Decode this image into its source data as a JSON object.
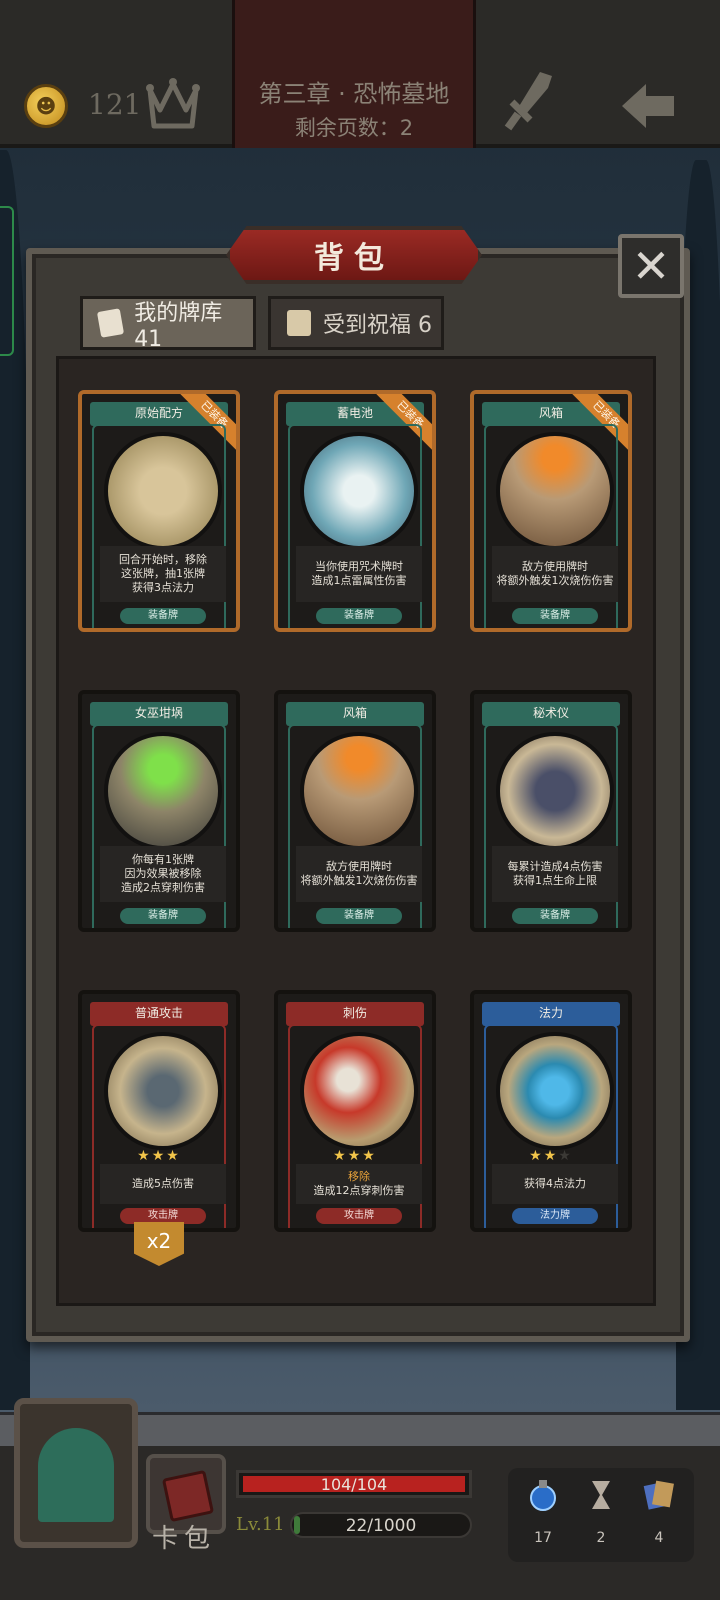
{
  "top": {
    "gold": "121",
    "chapter_title": "第三章 · 恐怖墓地",
    "pages_left": "剩余页数：2"
  },
  "panel": {
    "title": "背包",
    "close_glyph": "✕",
    "tabs": [
      {
        "label": "我的牌库 41",
        "active": true
      },
      {
        "label": "受到祝福 6",
        "active": false
      }
    ]
  },
  "cards": [
    {
      "name": "原始配方",
      "color": "green",
      "equipped": true,
      "equipped_label": "已装备",
      "desc": [
        "回合开始时，移除",
        "这张牌，抽1张牌",
        "获得3点法力"
      ],
      "kind": "装备牌"
    },
    {
      "name": "蓄电池",
      "color": "green",
      "equipped": true,
      "equipped_label": "已装备",
      "desc": [
        "当你使用咒术牌时",
        "造成1点雷属性伤害"
      ],
      "kind": "装备牌"
    },
    {
      "name": "风箱",
      "color": "green",
      "equipped": true,
      "equipped_label": "已装备",
      "desc": [
        "敌方使用牌时",
        "将额外触发1次烧伤伤害"
      ],
      "kind": "装备牌"
    },
    {
      "name": "女巫坩埚",
      "color": "green",
      "equipped": false,
      "desc": [
        "你每有1张牌",
        "因为效果被移除",
        "造成2点穿刺伤害"
      ],
      "kind": "装备牌"
    },
    {
      "name": "风箱",
      "color": "green",
      "equipped": false,
      "desc": [
        "敌方使用牌时",
        "将额外触发1次烧伤伤害"
      ],
      "kind": "装备牌"
    },
    {
      "name": "秘术仪",
      "color": "green",
      "equipped": false,
      "desc": [
        "每累计造成4点伤害",
        "获得1点生命上限"
      ],
      "kind": "装备牌"
    },
    {
      "name": "普通攻击",
      "color": "red",
      "equipped": false,
      "stars": 3,
      "desc": [
        "造成5点伤害"
      ],
      "kind": "攻击牌",
      "count_badge": "x2"
    },
    {
      "name": "刺伤",
      "color": "red",
      "equipped": false,
      "stars": 3,
      "desc": [
        "移除",
        "造成12点穿刺伤害"
      ],
      "kind": "攻击牌"
    },
    {
      "name": "法力",
      "color": "blue",
      "equipped": false,
      "stars": 2,
      "desc": [
        "获得4点法力"
      ],
      "kind": "法力牌"
    }
  ],
  "bottom": {
    "deck_label": "卡包",
    "hp": "104/104",
    "hp_fraction": 1.0,
    "level": "Lv.11",
    "xp": "22/1000",
    "xp_fraction": 0.022,
    "resources": [
      {
        "icon": "mana-potion-icon",
        "value": "17"
      },
      {
        "icon": "hourglass-icon",
        "value": "2"
      },
      {
        "icon": "cards-icon",
        "value": "4"
      }
    ]
  },
  "colors": {
    "accent_red": "#9a2a24",
    "equip_green": "#2f6a5c",
    "attack_red": "#8d2b27",
    "mana_blue": "#2c5d9a",
    "highlight_orange": "#e6a13a"
  }
}
